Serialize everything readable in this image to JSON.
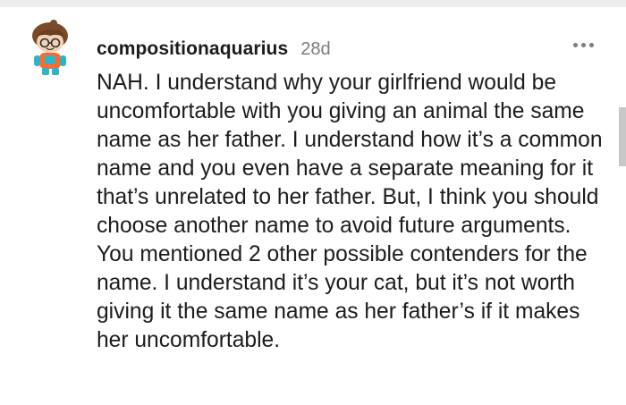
{
  "comment": {
    "username": "compositionaquarius",
    "age": "28d",
    "body": "NAH. I understand why your girlfriend would be uncomfortable with you giving an animal the same name as her father. I understand how it’s a common name and you even have a separate meaning for it that’s unrelated to her father. But, I think you should choose another name to avoid future arguments. You mentioned 2 other possible contenders for the name. I understand it’s your cat, but it’s not worth giving it the same name as her father’s if it makes her uncomfortable.",
    "avatar_icon": "snoo-avatar-icon",
    "more_icon": "more-options-icon"
  },
  "colors": {
    "text": "#1c1c1c",
    "meta": "#7c7c7c",
    "divider": "#eeeeee",
    "scrollbar": "#c8c8c8"
  }
}
